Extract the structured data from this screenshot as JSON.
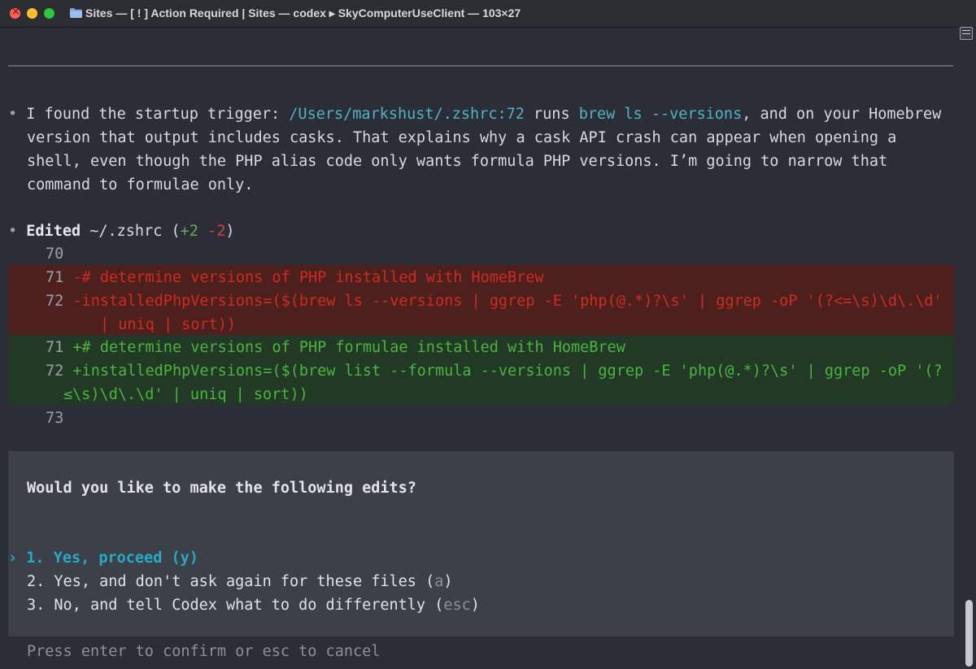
{
  "window": {
    "title": "Sites — [ ! ] Action Required | Sites — codex ▸ SkyComputerUseClient — 103×27"
  },
  "message": {
    "bullet": "•",
    "line1_prefix": "I found the startup trigger: ",
    "line1_path": "/Users/markshust/.zshrc:72",
    "line1_mid": " runs ",
    "line1_cmd": "brew ls --versions",
    "line1_suffix": ", and on your Homebrew",
    "line2": "version that output includes casks. That explains why a cask API crash can appear when opening a",
    "line3": "shell, even though the PHP alias code only wants formula PHP versions. I’m going to narrow that",
    "line4": "command to formulae only."
  },
  "edit": {
    "bullet": "•",
    "label": "Edited",
    "file": " ~/.zshrc (",
    "added": "+2",
    "space": " ",
    "removed": "-2",
    "close": ")"
  },
  "diff": {
    "context_before": {
      "num": "70",
      "text": ""
    },
    "removed": [
      {
        "num": "71",
        "text": "-# determine versions of PHP installed with HomeBrew"
      },
      {
        "num": "72",
        "text": "-installedPhpVersions=($(brew ls --versions | ggrep -E 'php(@.*)?\\s' | ggrep -oP '(?<=\\s)\\d\\.\\d'"
      },
      {
        "num": "",
        "text": "| uniq | sort))"
      }
    ],
    "added": [
      {
        "num": "71",
        "text": "+# determine versions of PHP formulae installed with HomeBrew"
      },
      {
        "num": "72",
        "text": "+installedPhpVersions=($(brew list --formula --versions | ggrep -E 'php(@.*)?\\s' | ggrep -oP '(?"
      },
      {
        "num": "",
        "text": "≤\\s)\\d\\.\\d' | uniq | sort))"
      }
    ],
    "context_after": {
      "num": "73",
      "text": ""
    }
  },
  "prompt": {
    "question": "Would you like to make the following edits?",
    "cursor": "›",
    "options": [
      {
        "label": "1. Yes, proceed (y)"
      },
      {
        "label": "2. Yes, and don't ask again for these files (",
        "key": "a",
        "close": ")"
      },
      {
        "label": "3. No, and tell Codex what to do differently (",
        "key": "esc",
        "close": ")"
      }
    ],
    "hint": "Press enter to confirm or esc to cancel"
  },
  "colors": {
    "background": "#2b2e36",
    "link": "#4fb3c7",
    "added": "#4bb43f",
    "removed": "#cf2b1f",
    "added_bg": "#223a25",
    "removed_bg": "#4d201e",
    "selected_option": "#29a9c4"
  }
}
